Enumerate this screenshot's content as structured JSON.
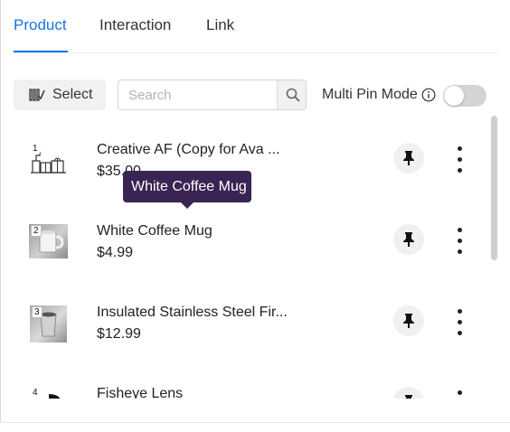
{
  "tabs": [
    {
      "label": "Product",
      "active": true
    },
    {
      "label": "Interaction",
      "active": false
    },
    {
      "label": "Link",
      "active": false
    }
  ],
  "toolbar": {
    "select_label": "Select",
    "search_placeholder": "Search",
    "search_value": "",
    "multi_pin_label": "Multi Pin Mode",
    "multi_pin_enabled": false
  },
  "products": [
    {
      "index": "1",
      "title": "Creative AF (Copy for Ava ...",
      "price": "$35.00",
      "icon": "gift-shop-icon"
    },
    {
      "index": "2",
      "title": "White Coffee Mug",
      "price": "$4.99",
      "icon": "mug-photo"
    },
    {
      "index": "3",
      "title": "Insulated Stainless Steel Fir...",
      "price": "$12.99",
      "icon": "tumbler-photo"
    },
    {
      "index": "4",
      "title": "Fisheye Lens",
      "price": "",
      "icon": "lens-photo"
    }
  ],
  "tooltip": {
    "text": "White Coffee Mug"
  },
  "colors": {
    "accent": "#1a73e8",
    "tooltip_bg": "#3a2453",
    "toggle_off": "#d4d4d4"
  }
}
